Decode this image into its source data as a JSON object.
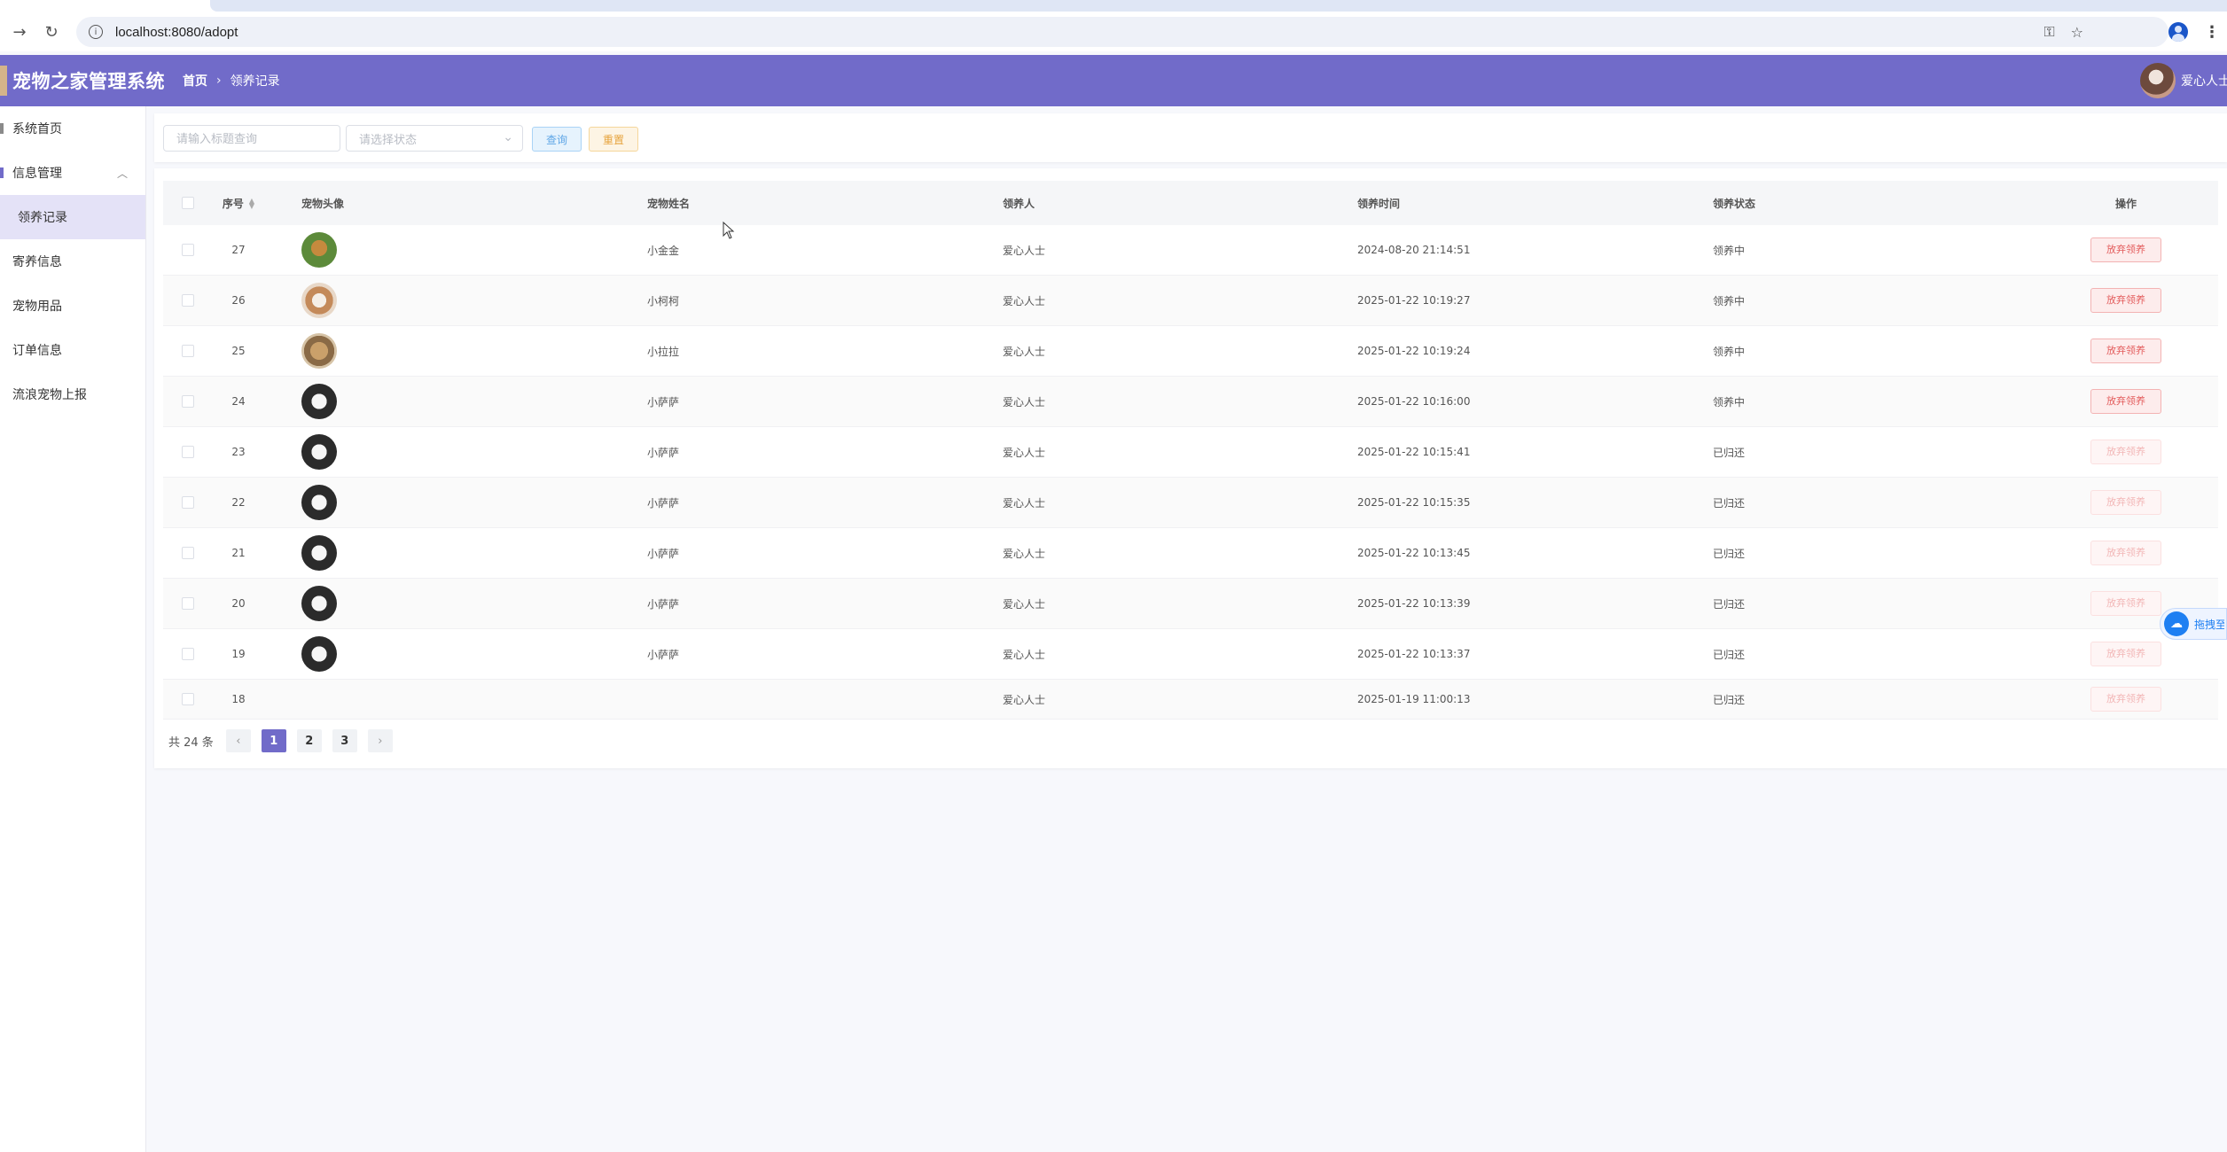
{
  "browser": {
    "url": "localhost:8080/adopt"
  },
  "header": {
    "app_title": "宠物之家管理系统",
    "breadcrumb": [
      "首页",
      "领养记录"
    ],
    "user_name": "爱心人士"
  },
  "sidebar": {
    "items": [
      {
        "label": "系统首页"
      },
      {
        "label": "信息管理"
      },
      {
        "label": "领养记录"
      },
      {
        "label": "寄养信息"
      },
      {
        "label": "宠物用品"
      },
      {
        "label": "订单信息"
      },
      {
        "label": "流浪宠物上报"
      }
    ]
  },
  "search": {
    "title_placeholder": "请输入标题查询",
    "status_placeholder": "请选择状态",
    "query_label": "查询",
    "reset_label": "重置"
  },
  "table": {
    "headers": [
      "序号",
      "宠物头像",
      "宠物姓名",
      "领养人",
      "领养时间",
      "领养状态",
      "操作"
    ],
    "action_label": "放弃领养",
    "rows": [
      {
        "id": "27",
        "pet_image": "golden-dog-icon",
        "pet_name": "小金金",
        "adopter": "爱心人士",
        "time": "2024-08-20 21:14:51",
        "status": "领养中",
        "action_enabled": true
      },
      {
        "id": "26",
        "pet_image": "corgi-icon",
        "pet_name": "小柯柯",
        "adopter": "爱心人士",
        "time": "2025-01-22 10:19:27",
        "status": "领养中",
        "action_enabled": true
      },
      {
        "id": "25",
        "pet_image": "labrador-icon",
        "pet_name": "小拉拉",
        "adopter": "爱心人士",
        "time": "2025-01-22 10:19:24",
        "status": "领养中",
        "action_enabled": true
      },
      {
        "id": "24",
        "pet_image": "samoyed-icon",
        "pet_name": "小萨萨",
        "adopter": "爱心人士",
        "time": "2025-01-22 10:16:00",
        "status": "领养中",
        "action_enabled": true
      },
      {
        "id": "23",
        "pet_image": "samoyed-icon",
        "pet_name": "小萨萨",
        "adopter": "爱心人士",
        "time": "2025-01-22 10:15:41",
        "status": "已归还",
        "action_enabled": false
      },
      {
        "id": "22",
        "pet_image": "samoyed-icon",
        "pet_name": "小萨萨",
        "adopter": "爱心人士",
        "time": "2025-01-22 10:15:35",
        "status": "已归还",
        "action_enabled": false
      },
      {
        "id": "21",
        "pet_image": "samoyed-icon",
        "pet_name": "小萨萨",
        "adopter": "爱心人士",
        "time": "2025-01-22 10:13:45",
        "status": "已归还",
        "action_enabled": false
      },
      {
        "id": "20",
        "pet_image": "samoyed-icon",
        "pet_name": "小萨萨",
        "adopter": "爱心人士",
        "time": "2025-01-22 10:13:39",
        "status": "已归还",
        "action_enabled": false
      },
      {
        "id": "19",
        "pet_image": "samoyed-icon",
        "pet_name": "小萨萨",
        "adopter": "爱心人士",
        "time": "2025-01-22 10:13:37",
        "status": "已归还",
        "action_enabled": false
      },
      {
        "id": "18",
        "pet_image": "",
        "pet_name": "",
        "adopter": "爱心人士",
        "time": "2025-01-19 11:00:13",
        "status": "已归还",
        "action_enabled": false
      }
    ]
  },
  "pagination": {
    "total_text": "共 24 条",
    "pages": [
      "1",
      "2",
      "3"
    ],
    "current": "1",
    "prev": "‹",
    "next": "›"
  },
  "float_tool": {
    "label": "拖拽至"
  },
  "colors": {
    "header_bg": "#716bc9",
    "active_menu_bg": "#e4e2f7",
    "danger": "#e35b5b"
  }
}
